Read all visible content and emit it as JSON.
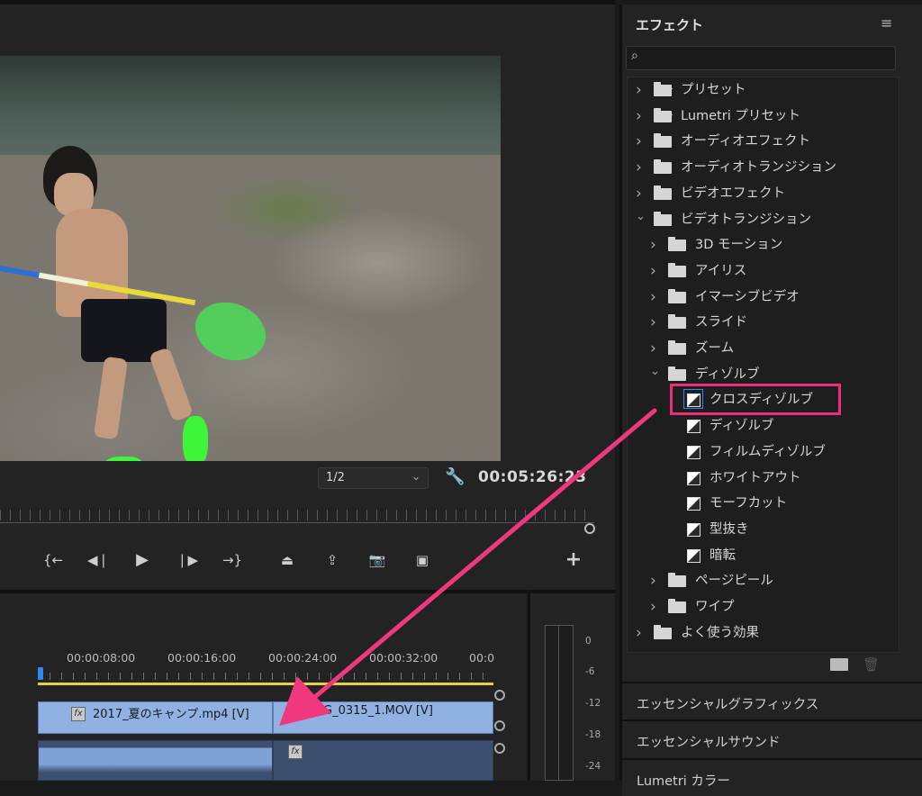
{
  "monitor": {
    "zoom": "1/2",
    "timecode": "00:05:26:23",
    "transport_icons": [
      "mark-in-icon",
      "step-back-icon",
      "play-icon",
      "step-forward-icon",
      "mark-out-icon",
      "lift-icon",
      "extract-icon",
      "camera-icon",
      "compare-icon",
      "add-icon"
    ]
  },
  "timeline": {
    "ruler_labels": [
      "00:00:08:00",
      "00:00:16:00",
      "00:00:24:00",
      "00:00:32:00",
      "00:0"
    ],
    "clips": [
      {
        "name": "2017_夏のキャンプ.mp4 [V]",
        "fx": "fx"
      },
      {
        "name": "IMG_0315_1.MOV [V]",
        "fx": ""
      }
    ],
    "audio_fx": "fx"
  },
  "meters": {
    "labels": [
      "0",
      "-6",
      "-12",
      "-18",
      "-24"
    ]
  },
  "effects": {
    "title": "エフェクト",
    "menu_icon": "≡",
    "tree": [
      {
        "label": "プリセット",
        "level": 0,
        "kind": "preset-folder",
        "expanded": false
      },
      {
        "label": "Lumetri プリセット",
        "level": 0,
        "kind": "preset-folder",
        "expanded": false
      },
      {
        "label": "オーディオエフェクト",
        "level": 0,
        "kind": "folder",
        "expanded": false
      },
      {
        "label": "オーディオトランジション",
        "level": 0,
        "kind": "folder",
        "expanded": false
      },
      {
        "label": "ビデオエフェクト",
        "level": 0,
        "kind": "folder",
        "expanded": false
      },
      {
        "label": "ビデオトランジション",
        "level": 0,
        "kind": "folder",
        "expanded": true
      },
      {
        "label": "3D モーション",
        "level": 1,
        "kind": "folder",
        "expanded": false
      },
      {
        "label": "アイリス",
        "level": 1,
        "kind": "folder",
        "expanded": false
      },
      {
        "label": "イマーシブビデオ",
        "level": 1,
        "kind": "folder",
        "expanded": false
      },
      {
        "label": "スライド",
        "level": 1,
        "kind": "folder",
        "expanded": false
      },
      {
        "label": "ズーム",
        "level": 1,
        "kind": "folder",
        "expanded": false
      },
      {
        "label": "ディゾルブ",
        "level": 1,
        "kind": "folder",
        "expanded": true
      },
      {
        "label": "クロスディゾルブ",
        "level": 2,
        "kind": "transition",
        "selected": true
      },
      {
        "label": "ディゾルブ",
        "level": 2,
        "kind": "transition"
      },
      {
        "label": "フィルムディゾルブ",
        "level": 2,
        "kind": "transition"
      },
      {
        "label": "ホワイトアウト",
        "level": 2,
        "kind": "transition"
      },
      {
        "label": "モーフカット",
        "level": 2,
        "kind": "transition"
      },
      {
        "label": "型抜き",
        "level": 2,
        "kind": "transition"
      },
      {
        "label": "暗転",
        "level": 2,
        "kind": "transition"
      },
      {
        "label": "ページピール",
        "level": 1,
        "kind": "folder",
        "expanded": false
      },
      {
        "label": "ワイプ",
        "level": 1,
        "kind": "folder",
        "expanded": false
      },
      {
        "label": "よく使う効果",
        "level": 0,
        "kind": "folder",
        "expanded": false
      }
    ],
    "bottom_panels": [
      "エッセンシャルグラフィックス",
      "エッセンシャルサウンド",
      "Lumetri カラー"
    ]
  },
  "colors": {
    "highlight": "#e8317a",
    "arrow": "#f0387f",
    "clip": "#8fb2e3",
    "work_area": "#e7d23a",
    "playhead": "#2d8ceb"
  }
}
